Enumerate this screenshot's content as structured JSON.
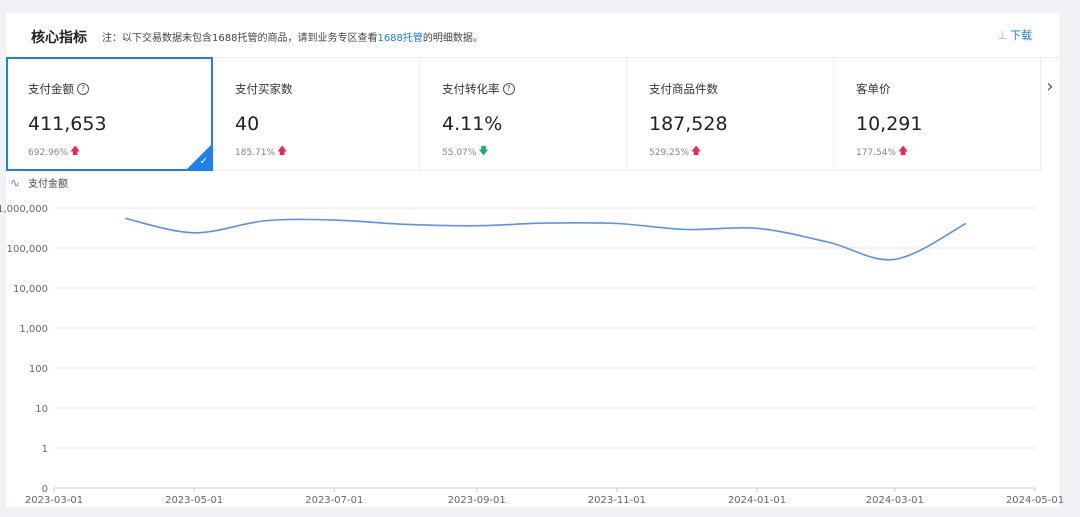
{
  "header": {
    "title": "核心指标",
    "note_prefix": "注：以下交易数据未包含1688托管的商品，请到业务专区查看",
    "note_link": "1688托管",
    "note_suffix": "的明细数据。",
    "download_label": "下载",
    "download_icon": "download-icon"
  },
  "metrics": [
    {
      "label": "支付金额",
      "has_help": true,
      "value": "411,653",
      "change": "692.96%",
      "trend": "up",
      "active": true
    },
    {
      "label": "支付买家数",
      "has_help": false,
      "value": "40",
      "change": "185.71%",
      "trend": "up",
      "active": false
    },
    {
      "label": "支付转化率",
      "has_help": true,
      "value": "4.11%",
      "change": "55.07%",
      "trend": "down",
      "active": false
    },
    {
      "label": "支付商品件数",
      "has_help": false,
      "value": "187,528",
      "change": "529.25%",
      "trend": "up",
      "active": false
    },
    {
      "label": "客单价",
      "has_help": false,
      "value": "10,291",
      "change": "177.54%",
      "trend": "up",
      "active": false
    }
  ],
  "legend": {
    "label": "支付金额"
  },
  "colors": {
    "accent": "#1f7ff0",
    "line": "#5b8ff9",
    "up": "#f0274a",
    "down": "#17b26a"
  },
  "chart_data": {
    "type": "line",
    "yscale": "log",
    "grid": true,
    "ytick_labels": [
      "0",
      "1",
      "10",
      "100",
      "1,000",
      "10,000",
      "100,000",
      "1,000,000"
    ],
    "xtick_labels": [
      "2023-03-01",
      "2023-05-01",
      "2023-07-01",
      "2023-09-01",
      "2023-11-01",
      "2024-01-01",
      "2024-03-01",
      "2024-05-01"
    ],
    "series": [
      {
        "name": "支付金额",
        "points": [
          {
            "x": "2023-04-01",
            "y": 550000
          },
          {
            "x": "2023-05-01",
            "y": 240000
          },
          {
            "x": "2023-06-01",
            "y": 480000
          },
          {
            "x": "2023-07-01",
            "y": 500000
          },
          {
            "x": "2023-08-01",
            "y": 390000
          },
          {
            "x": "2023-09-01",
            "y": 360000
          },
          {
            "x": "2023-10-01",
            "y": 420000
          },
          {
            "x": "2023-11-01",
            "y": 410000
          },
          {
            "x": "2023-12-01",
            "y": 290000
          },
          {
            "x": "2024-01-01",
            "y": 310000
          },
          {
            "x": "2024-02-01",
            "y": 140000
          },
          {
            "x": "2024-03-01",
            "y": 52000
          },
          {
            "x": "2024-04-01",
            "y": 411653
          }
        ]
      }
    ]
  }
}
